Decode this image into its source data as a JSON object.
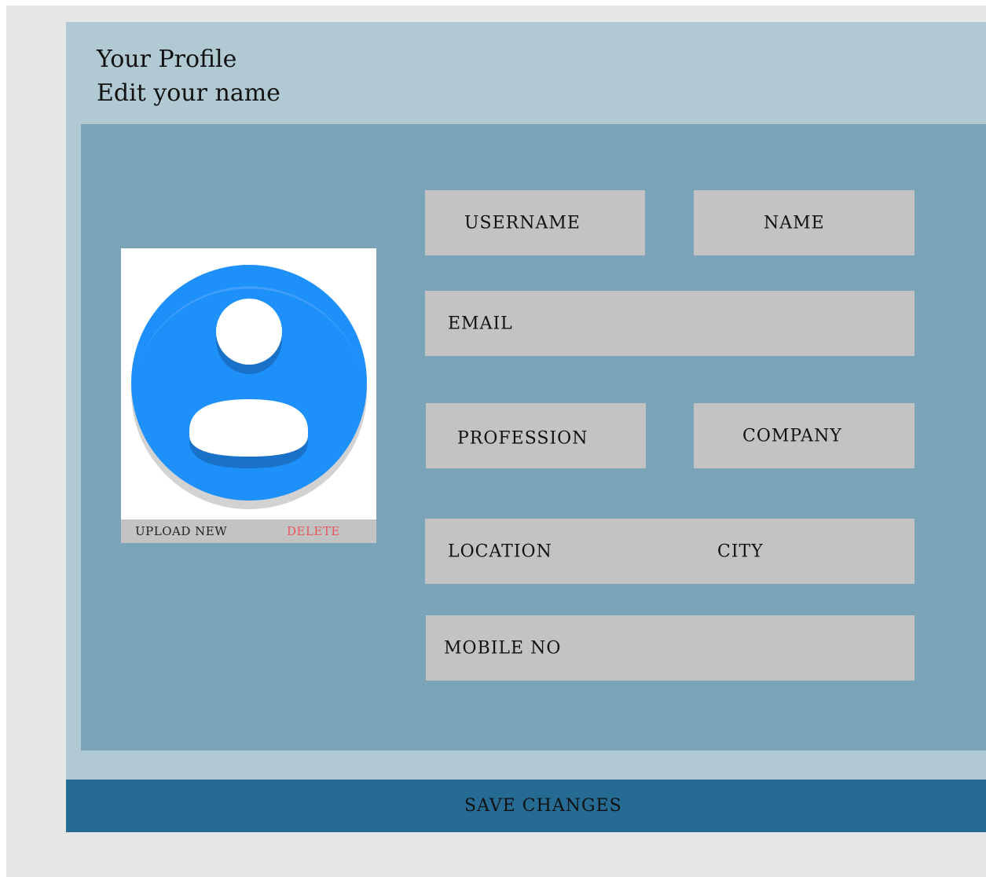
{
  "header": {
    "title": "Your Profile",
    "subtitle": "Edit your name"
  },
  "photo": {
    "icon": "user-avatar-icon",
    "upload_label": "UPLOAD NEW",
    "delete_label": "DELETE"
  },
  "fields": {
    "username": "USERNAME",
    "name": "NAME",
    "email": "EMAIL",
    "profession": "PROFESSION",
    "company": "COMPANY",
    "location": "LOCATION",
    "city": "CITY",
    "mobile": "MOBILE NO"
  },
  "footer": {
    "save_label": "SAVE CHANGES"
  },
  "colors": {
    "page_bg": "#e6e6e6",
    "panel_bg": "#b0c9d3",
    "form_bg": "#7ba4b9",
    "field_bg": "#c3c3c3",
    "save_bar": "#266b93",
    "avatar_blue": "#1e90fa",
    "delete_red": "#e8585a"
  }
}
